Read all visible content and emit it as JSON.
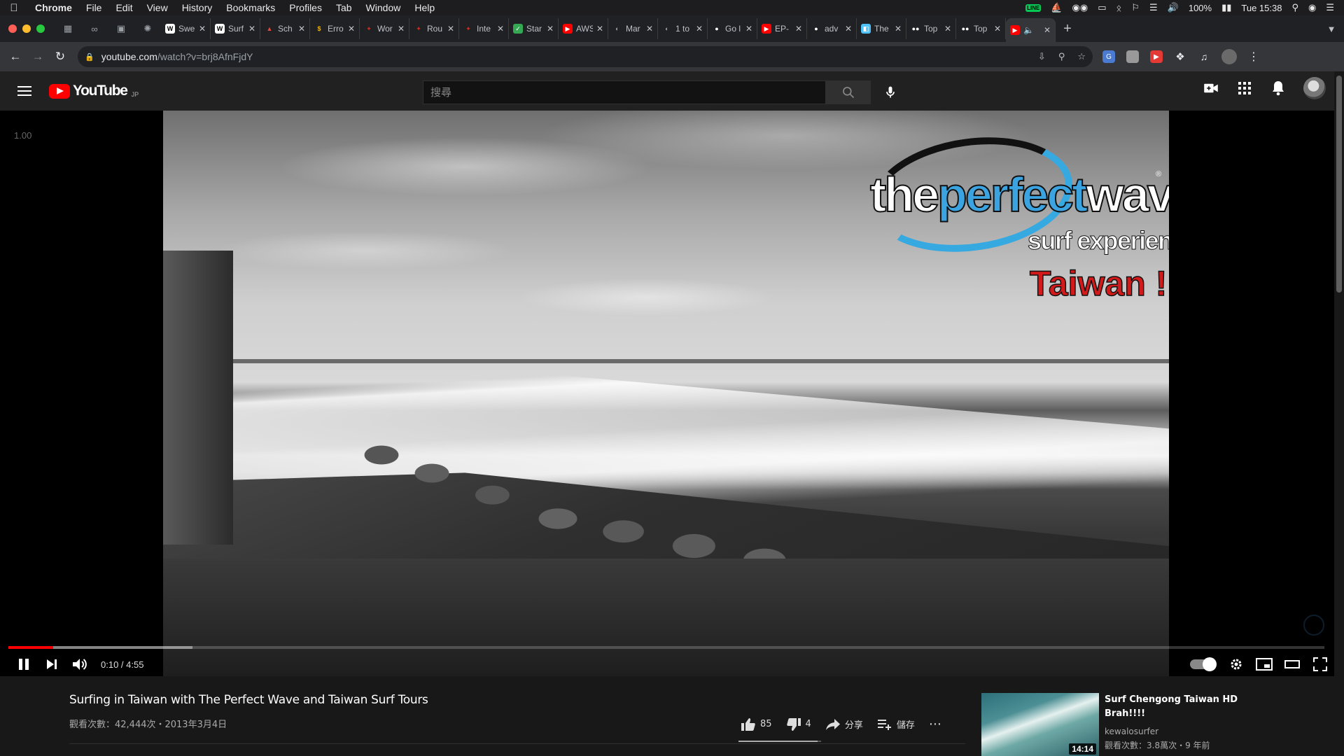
{
  "menubar": {
    "app": "Chrome",
    "items": [
      "File",
      "Edit",
      "View",
      "History",
      "Bookmarks",
      "Profiles",
      "Tab",
      "Window",
      "Help"
    ],
    "battery": "100%",
    "clock": "Tue 15:38"
  },
  "tabs": {
    "pinned": [
      {
        "icon": "sheets-icon"
      },
      {
        "icon": "link-icon"
      },
      {
        "icon": "photo-icon"
      },
      {
        "icon": "openai-icon"
      }
    ],
    "items": [
      {
        "label": "Swe",
        "icon": "wikipedia-icon",
        "fav_text": "W",
        "fav_bg": "#ffffff",
        "fav_fg": "#000000"
      },
      {
        "label": "Surf",
        "icon": "wikipedia-icon",
        "fav_text": "W",
        "fav_bg": "#ffffff",
        "fav_fg": "#000000"
      },
      {
        "label": "Sch",
        "icon": "triangle-icon",
        "fav_text": "▲",
        "fav_bg": "#202124",
        "fav_fg": "#e8453c"
      },
      {
        "label": "Erro",
        "icon": "bolt-icon",
        "fav_text": "$",
        "fav_bg": "#202124",
        "fav_fg": "#f4b400"
      },
      {
        "label": "Wor",
        "icon": "maple-leaf-icon",
        "fav_text": "✦",
        "fav_bg": "#202124",
        "fav_fg": "#d52b1e"
      },
      {
        "label": "Rou",
        "icon": "maple-leaf-icon",
        "fav_text": "✦",
        "fav_bg": "#202124",
        "fav_fg": "#d52b1e"
      },
      {
        "label": "Inte",
        "icon": "maple-leaf-icon",
        "fav_text": "✦",
        "fav_bg": "#202124",
        "fav_fg": "#d52b1e"
      },
      {
        "label": "Star",
        "icon": "check-icon",
        "fav_text": "✓",
        "fav_bg": "#34a853",
        "fav_fg": "#ffffff"
      },
      {
        "label": "AWS",
        "icon": "youtube-icon",
        "fav_text": "▶",
        "fav_bg": "#ff0000",
        "fav_fg": "#ffffff"
      },
      {
        "label": "Mar",
        "icon": "globe-icon",
        "fav_text": "◐",
        "fav_bg": "#202124",
        "fav_fg": "#9aa0a6"
      },
      {
        "label": "1 to",
        "icon": "globe-icon",
        "fav_text": "◐",
        "fav_bg": "#202124",
        "fav_fg": "#9aa0a6"
      },
      {
        "label": "Go l",
        "icon": "github-icon",
        "fav_text": "●",
        "fav_bg": "#202124",
        "fav_fg": "#ffffff"
      },
      {
        "label": "EP-",
        "icon": "youtube-icon",
        "fav_text": "▶",
        "fav_bg": "#ff0000",
        "fav_fg": "#ffffff"
      },
      {
        "label": "adv",
        "icon": "github-icon",
        "fav_text": "●",
        "fav_bg": "#202124",
        "fav_fg": "#ffffff"
      },
      {
        "label": "The",
        "icon": "bookmark-icon",
        "fav_text": "◧",
        "fav_bg": "#4fc3f7",
        "fav_fg": "#ffffff"
      },
      {
        "label": "Top",
        "icon": "medium-icon",
        "fav_text": "●●",
        "fav_bg": "#202124",
        "fav_fg": "#ffffff"
      },
      {
        "label": "Top",
        "icon": "medium-icon",
        "fav_text": "●●",
        "fav_bg": "#202124",
        "fav_fg": "#ffffff"
      }
    ],
    "active": {
      "icon": "youtube-icon",
      "audio_icon": "speaker-icon"
    }
  },
  "toolbar": {
    "url_host": "youtube.com",
    "url_path": "/watch?v=brj8AfnFjdY"
  },
  "youtube": {
    "wordmark": "YouTube",
    "region": "JP",
    "search_placeholder": "搜尋"
  },
  "player": {
    "speed_readout": "1.00",
    "overlay": {
      "line1_a": "the",
      "line1_b": "perfect",
      "line1_c": "wave",
      "line2": "surf experience",
      "line3": "Taiwan !",
      "reg": "®"
    },
    "time": "0:10 / 4:55",
    "elapsed_seconds": 10,
    "duration_seconds": 295,
    "buffered_fraction": 0.14
  },
  "video": {
    "title": "Surfing in Taiwan with The Perfect Wave and Taiwan Surf Tours",
    "meta": "觀看次數：42,444次・2013年3月4日",
    "likes": "85",
    "dislikes": "4",
    "share_label": "分享",
    "save_label": "儲存",
    "like_fraction": 0.955
  },
  "recommendation": {
    "title": "Surf Chengong Taiwan HD Brah!!!!",
    "channel": "kewalosurfer",
    "stats": "觀看次數：3.8萬次・9 年前",
    "duration": "14:14"
  },
  "colors": {
    "yt_red": "#ff0000",
    "brand_blue": "#3aa3e0",
    "taiwan_red": "#d21a1a"
  }
}
